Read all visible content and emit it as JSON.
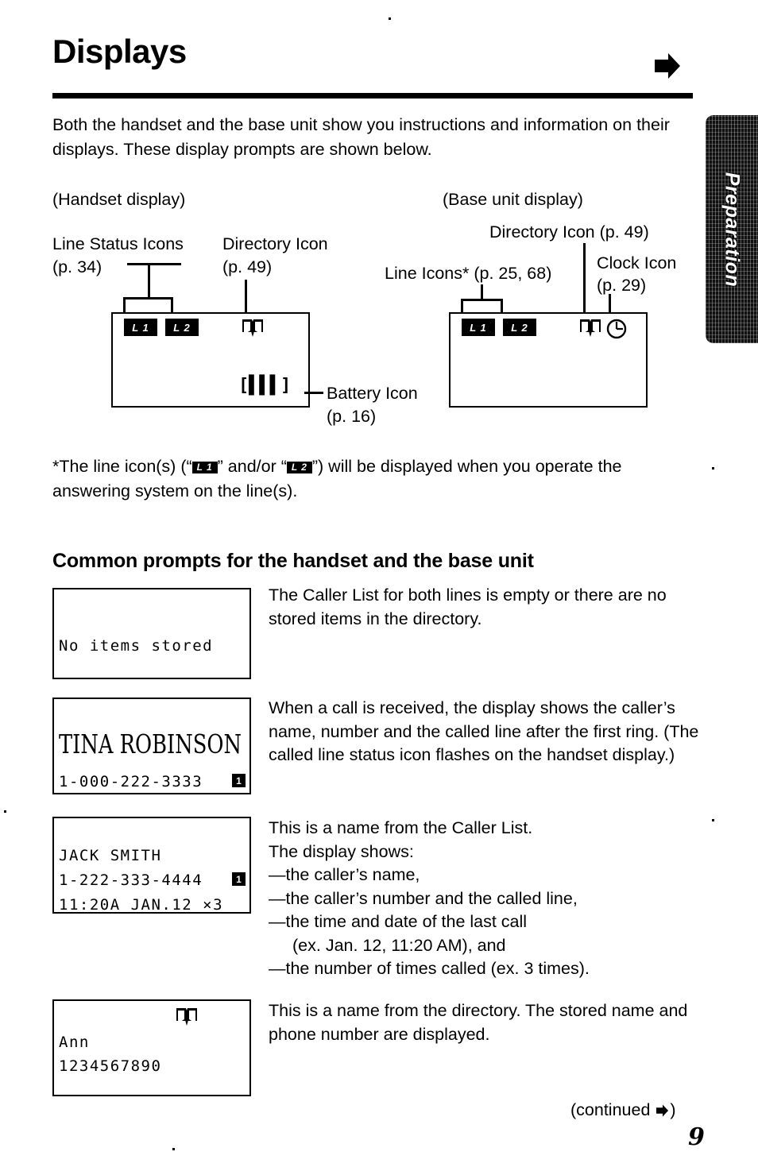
{
  "header": {
    "title": "Displays",
    "arrow_icon": "right-arrow-icon"
  },
  "intro": "Both the handset and the base unit show you instructions and information on their displays. These display prompts are shown below.",
  "thumb_tab": {
    "label": "Preparation"
  },
  "diagram": {
    "handset_caption": "(Handset display)",
    "base_caption": "(Base unit display)",
    "labels": {
      "line_status_icons": "Line Status Icons",
      "line_status_icons_page": "(p. 34)",
      "directory_icon_handset": "Directory Icon",
      "directory_icon_handset_page": "(p. 49)",
      "battery_icon": "Battery Icon",
      "battery_icon_page": "(p. 16)",
      "directory_icon_base": "Directory Icon (p. 49)",
      "line_icons_base": "Line Icons* (p. 25, 68)",
      "clock_icon": "Clock Icon",
      "clock_icon_page": "(p. 29)"
    },
    "handset_display": {
      "line1_chip": "L 1",
      "line2_chip": "L 2",
      "battery": "[▌▌▌]"
    },
    "base_display": {
      "line1_chip": "L 1",
      "line2_chip": "L 2"
    }
  },
  "footnote": {
    "part1": "*The line icon(s) (“",
    "chip1": "L 1",
    "part2": "” and/or “",
    "chip2": "L 2",
    "part3": "”) will be displayed when you operate the answering system on the line(s)."
  },
  "section_heading": "Common prompts for the handset and the base unit",
  "prompts": [
    {
      "display_lines": [
        "No items stored"
      ],
      "description": "The Caller List for both lines is empty or there are no stored items in the directory."
    },
    {
      "name_line": "TINA ROBINSON",
      "number_line": "1-000-222-3333",
      "line_badge": "1",
      "description": "When a call is received, the display shows the caller’s name, number and the called line after the first ring. (The called line status icon flashes on the handset display.)"
    },
    {
      "display_lines": [
        "JACK SMITH",
        "1-222-333-4444",
        "11:20A JAN.12 ×3"
      ],
      "line_badge": "1",
      "description_lines": [
        "This is a name from the Caller List.",
        "The display shows:",
        "—the caller’s name,",
        "—the caller’s number and the called line,",
        "—the time and date of the last call",
        "(ex. Jan. 12, 11:20 AM), and",
        "—the number of times called (ex. 3 times)."
      ]
    },
    {
      "display_lines": [
        "Ann",
        "1234567890"
      ],
      "icon": "directory-book-icon",
      "description": "This is a name from the directory. The stored name and phone number are displayed."
    }
  ],
  "footer": {
    "continued_prefix": "(continued ",
    "continued_suffix": ")",
    "page_number": "9"
  }
}
